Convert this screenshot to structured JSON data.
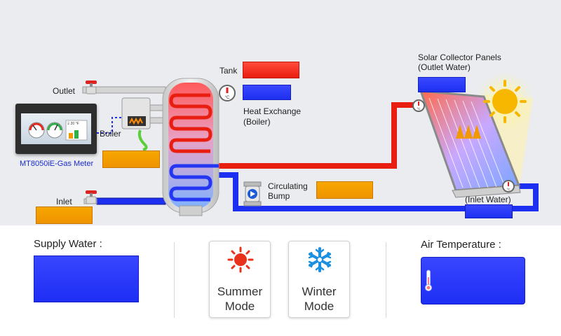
{
  "diagram": {
    "labels": {
      "outlet": "Outlet",
      "boiler": "Boiler",
      "inlet": "Inlet",
      "device": "MT8050iE-Gas Meter",
      "tank": "Tank",
      "heat_exchange_line1": "Heat Exchange",
      "heat_exchange_line2": "(Boiler)",
      "circulating_line1": "Circulating",
      "circulating_line2": "Bump",
      "solar_line1": "Solar Collector Panels",
      "solar_line2": "(Outlet Water)",
      "inlet_water": "(Inlet Water)",
      "temp_unit": "°C"
    },
    "hmi_screen_text": {
      "left": "",
      "right": "Ξ 20 °F"
    },
    "colors": {
      "hot_pipe": "#e81e10",
      "cold_pipe": "#1d2ff0",
      "field_orange": "#f29800",
      "field_blue": "#1d2ff0",
      "field_red": "#ec2a1c",
      "sun": "#f7b600"
    }
  },
  "bottom": {
    "supply_water_label": "Supply Water :",
    "summer": {
      "line1": "Summer",
      "line2": "Mode"
    },
    "winter": {
      "line1": "Winter",
      "line2": "Mode"
    },
    "air_temperature_label": "Air Temperature :"
  },
  "icons": {
    "sun": "sun-icon",
    "snowflake": "snowflake-icon",
    "thermometer": "thermometer-icon",
    "valve": "valve-icon",
    "gauge": "temperature-gauge-icon",
    "pump": "pump-icon"
  }
}
